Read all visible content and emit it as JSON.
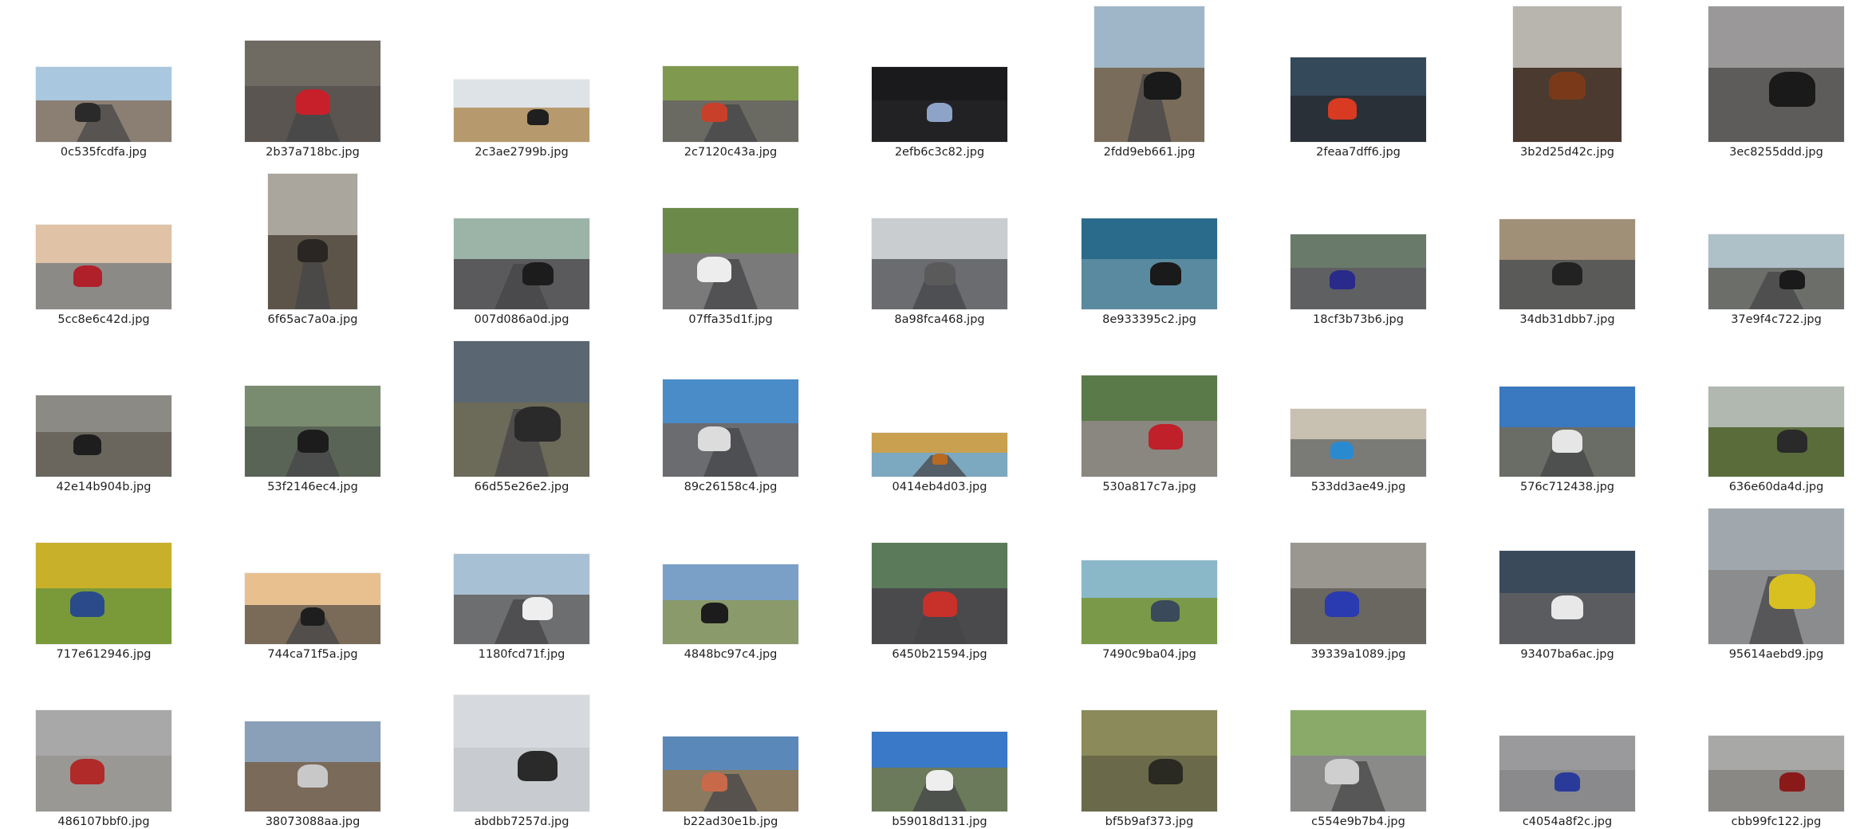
{
  "files": [
    {
      "name": "0c535fcdfa.jpg",
      "sky": "#a9c8e0",
      "ground": "#8a7f72",
      "subject": "#2a2a2a",
      "road": true
    },
    {
      "name": "2b37a718bc.jpg",
      "sky": "#6f6a62",
      "ground": "#5a5550",
      "subject": "#c8202a",
      "road": true
    },
    {
      "name": "2c3ae2799b.jpg",
      "sky": "#dde3e6",
      "ground": "#b69a6e",
      "subject": "#1f1f1f",
      "road": false
    },
    {
      "name": "2c7120c43a.jpg",
      "sky": "#7f9a4e",
      "ground": "#6b6a62",
      "subject": "#c8402a",
      "road": true
    },
    {
      "name": "2efb6c3c82.jpg",
      "sky": "#1a1a1c",
      "ground": "#222224",
      "subject": "#8da3c7",
      "road": false
    },
    {
      "name": "2fdd9eb661.jpg",
      "sky": "#9fb6c9",
      "ground": "#7a6c5a",
      "subject": "#1a1a1a",
      "road": true
    },
    {
      "name": "2feaa7dff6.jpg",
      "sky": "#34495a",
      "ground": "#2a3038",
      "subject": "#d83a22",
      "road": false
    },
    {
      "name": "3b2d25d42c.jpg",
      "sky": "#b8b4ae",
      "ground": "#4a3a30",
      "subject": "#7a3a1a",
      "road": false
    },
    {
      "name": "3ec8255ddd.jpg",
      "sky": "#9a9898",
      "ground": "#5e5c5a",
      "subject": "#1a1a1a",
      "road": false
    },
    {
      "name": "5cc8e6c42d.jpg",
      "sky": "#e0c2a6",
      "ground": "#8c8a86",
      "subject": "#b0202a",
      "road": false
    },
    {
      "name": "6f65ac7a0a.jpg",
      "sky": "#aaa69e",
      "ground": "#5c5448",
      "subject": "#2a2624",
      "road": true
    },
    {
      "name": "007d086a0d.jpg",
      "sky": "#9cb4a8",
      "ground": "#5a5a5c",
      "subject": "#1c1c1c",
      "road": true
    },
    {
      "name": "07ffa35d1f.jpg",
      "sky": "#6b8a4a",
      "ground": "#7a7a7a",
      "subject": "#ededed",
      "road": true
    },
    {
      "name": "8a98fca468.jpg",
      "sky": "#c9cdd0",
      "ground": "#6a6c70",
      "subject": "#5a5a5a",
      "road": true
    },
    {
      "name": "8e933395c2.jpg",
      "sky": "#2a6a8a",
      "ground": "#5a8aa0",
      "subject": "#1a1a1a",
      "road": false
    },
    {
      "name": "18cf3b73b6.jpg",
      "sky": "#6a7a6a",
      "ground": "#5f6062",
      "subject": "#2a2a8a",
      "road": false
    },
    {
      "name": "34db31dbb7.jpg",
      "sky": "#a09078",
      "ground": "#5a5a58",
      "subject": "#222222",
      "road": false
    },
    {
      "name": "37e9f4c722.jpg",
      "sky": "#aec0c8",
      "ground": "#6c6e6a",
      "subject": "#1a1a1a",
      "road": true
    },
    {
      "name": "42e14b904b.jpg",
      "sky": "#8c8a84",
      "ground": "#6a665e",
      "subject": "#1e1e1e",
      "road": false
    },
    {
      "name": "53f2146ec4.jpg",
      "sky": "#7a8c70",
      "ground": "#5a6456",
      "subject": "#1c1c1c",
      "road": true
    },
    {
      "name": "66d55e26e2.jpg",
      "sky": "#5a6672",
      "ground": "#6c6a58",
      "subject": "#2a2a2a",
      "road": true
    },
    {
      "name": "89c26158c4.jpg",
      "sky": "#4a8cc8",
      "ground": "#6a6c70",
      "subject": "#dcdcdc",
      "road": true
    },
    {
      "name": "0414eb4d03.jpg",
      "sky": "#c8a050",
      "ground": "#7ca8c0",
      "subject": "#b86a20",
      "road": true
    },
    {
      "name": "530a817c7a.jpg",
      "sky": "#5a7a4a",
      "ground": "#8a8680",
      "subject": "#c0202a",
      "road": false
    },
    {
      "name": "533dd3ae49.jpg",
      "sky": "#c8c0b0",
      "ground": "#7a7a76",
      "subject": "#2a8ad0",
      "road": false
    },
    {
      "name": "576c712438.jpg",
      "sky": "#3a78c0",
      "ground": "#6a6c66",
      "subject": "#e6e6e6",
      "road": true
    },
    {
      "name": "636e60da4d.jpg",
      "sky": "#b0b8b0",
      "ground": "#5a6c3a",
      "subject": "#2a2a2a",
      "road": false
    },
    {
      "name": "717e612946.jpg",
      "sky": "#c8b02a",
      "ground": "#7a9a3a",
      "subject": "#2a4a8a",
      "road": false
    },
    {
      "name": "744ca71f5a.jpg",
      "sky": "#e8c090",
      "ground": "#7a6a58",
      "subject": "#1e1e1e",
      "road": true
    },
    {
      "name": "1180fcd71f.jpg",
      "sky": "#a8c0d4",
      "ground": "#6c6e70",
      "subject": "#eeeeee",
      "road": true
    },
    {
      "name": "4848bc97c4.jpg",
      "sky": "#7aa0c8",
      "ground": "#8a9a6a",
      "subject": "#1c1c1c",
      "road": false
    },
    {
      "name": "6450b21594.jpg",
      "sky": "#5a7a5a",
      "ground": "#4a4a4c",
      "subject": "#c8302a",
      "road": true
    },
    {
      "name": "7490c9ba04.jpg",
      "sky": "#8ab8c8",
      "ground": "#7a9a4a",
      "subject": "#3a4a5a",
      "road": false
    },
    {
      "name": "39339a1089.jpg",
      "sky": "#9a9690",
      "ground": "#6a6660",
      "subject": "#2a3ab0",
      "road": false
    },
    {
      "name": "93407ba6ac.jpg",
      "sky": "#3a4a5a",
      "ground": "#5a5c60",
      "subject": "#e8e8e8",
      "road": false
    },
    {
      "name": "95614aebd9.jpg",
      "sky": "#a0a8ae",
      "ground": "#8a8c8e",
      "subject": "#d8c020",
      "road": true
    },
    {
      "name": "486107bbf0.jpg",
      "sky": "#a8a8a8",
      "ground": "#9a9894",
      "subject": "#b02a2a",
      "road": false
    },
    {
      "name": "38073088aa.jpg",
      "sky": "#8aa0b8",
      "ground": "#7a6a5a",
      "subject": "#c8c8c8",
      "road": false
    },
    {
      "name": "abdbb7257d.jpg",
      "sky": "#d6dade",
      "ground": "#c8ccd0",
      "subject": "#2a2a2a",
      "road": false
    },
    {
      "name": "b22ad30e1b.jpg",
      "sky": "#5a88b8",
      "ground": "#8a7a60",
      "subject": "#c86a4a",
      "road": true
    },
    {
      "name": "b59018d131.jpg",
      "sky": "#3a78c8",
      "ground": "#6a7a5a",
      "subject": "#eeeeee",
      "road": true
    },
    {
      "name": "bf5b9af373.jpg",
      "sky": "#8a8a5a",
      "ground": "#6a6a4a",
      "subject": "#2a2a22",
      "road": false
    },
    {
      "name": "c554e9b7b4.jpg",
      "sky": "#8aaa6a",
      "ground": "#8a8a88",
      "subject": "#cfcfcf",
      "road": true
    },
    {
      "name": "c4054a8f2c.jpg",
      "sky": "#9a9a9c",
      "ground": "#8a8a8c",
      "subject": "#2a3a9a",
      "road": false
    },
    {
      "name": "cbb99fc122.jpg",
      "sky": "#a8a8a6",
      "ground": "#8a8884",
      "subject": "#8a1a1a",
      "road": false
    }
  ]
}
